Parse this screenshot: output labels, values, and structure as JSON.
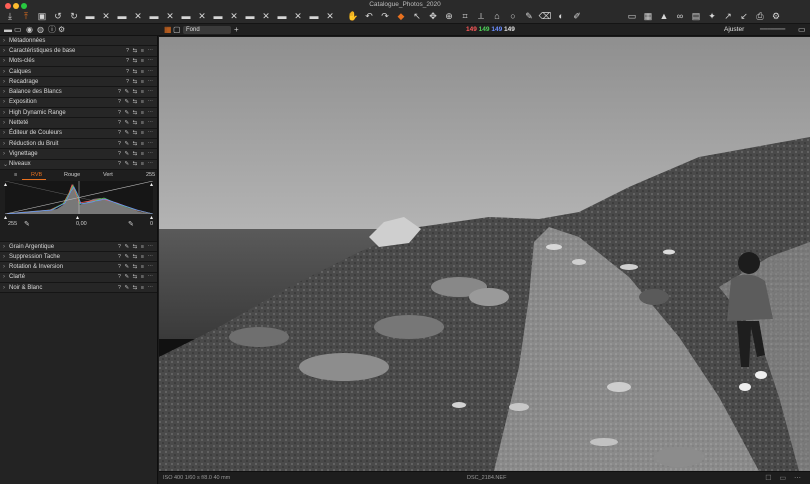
{
  "window": {
    "title": "Catalogue_Photos_2020"
  },
  "toolbar": {
    "icons_left": [
      "import-icon",
      "export-icon",
      "camera-icon",
      "rotate-left-icon",
      "rotate-right-icon",
      "folder-icon",
      "close-icon",
      "folder-icon",
      "close-icon",
      "folder-icon",
      "close-icon",
      "folder-icon",
      "close-icon",
      "folder-icon",
      "close-icon",
      "folder-icon",
      "close-icon",
      "folder-icon",
      "close-icon",
      "folder-icon",
      "close-icon"
    ],
    "icons_mid": [
      "hand-icon",
      "undo-icon",
      "redo-icon",
      "reset-icon",
      "cursor-icon",
      "pan-icon",
      "picker-icon",
      "crop-icon",
      "straighten-icon",
      "keystone-icon",
      "circle-mask-icon",
      "brush-icon",
      "eraser-icon",
      "gradient-icon",
      "annotation-icon"
    ],
    "icons_right": [
      "viewer-icon",
      "grid-icon",
      "warning-icon",
      "glasses-icon",
      "browser-icon",
      "wand-icon",
      "copy-adjust-icon",
      "apply-icon",
      "print-icon",
      "settings-icon"
    ]
  },
  "subbar": {
    "layer_select": "Fond",
    "readout_r": "149",
    "readout_g": "149",
    "readout_b": "149",
    "readout_l": "149",
    "fit_label": "Ajuster",
    "colors": {
      "r": "#ff5a5a",
      "g": "#4ed35a",
      "b": "#6a8dff",
      "l": "#e0e0e0"
    }
  },
  "tools_top": [
    {
      "label": "Métadonnées",
      "acts": ""
    },
    {
      "label": "Caractéristiques de base",
      "acts": "? ⇆ ≡ ⋯"
    },
    {
      "label": "Mots-clés",
      "acts": "? ⇆ ≡ ⋯"
    },
    {
      "label": "Calques",
      "acts": "? ⇆ ≡ ⋯"
    },
    {
      "label": "Recadrage",
      "acts": "? ⇆ ≡ ⋯"
    },
    {
      "label": "Balance des Blancs",
      "acts": "? ✎ ⇆ ≡ ⋯"
    },
    {
      "label": "Exposition",
      "acts": "? ✎ ⇆ ≡ ⋯"
    },
    {
      "label": "High Dynamic Range",
      "acts": "? ✎ ⇆ ≡ ⋯"
    },
    {
      "label": "Netteté",
      "acts": "? ✎ ⇆ ≡ ⋯"
    },
    {
      "label": "Éditeur de Couleurs",
      "acts": "? ✎ ⇆ ≡ ⋯"
    },
    {
      "label": "Réduction du Bruit",
      "acts": "? ✎ ⇆ ≡ ⋯"
    },
    {
      "label": "Vignettage",
      "acts": "? ✎ ⇆ ≡ ⋯"
    },
    {
      "label": "Niveaux",
      "acts": "? ✎ ⇆ ≡ ⋯"
    }
  ],
  "levels": {
    "tab_first": "≡",
    "tab_rgb": "RVB",
    "tab_red": "Rouge",
    "tab_green": "Vert",
    "top_right": "255",
    "bottom_left": "255",
    "bottom_mid": "0,00",
    "bottom_right": "0",
    "accent": "#e8711f"
  },
  "tools_bottom": [
    {
      "label": "Grain Argentique",
      "acts": "? ✎ ⇆ ≡ ⋯"
    },
    {
      "label": "Suppression Tache",
      "acts": "? ✎ ⇆ ≡ ⋯"
    },
    {
      "label": "Rotation & Inversion",
      "acts": "? ✎ ⇆ ≡ ⋯"
    },
    {
      "label": "Clarté",
      "acts": "? ✎ ⇆ ≡ ⋯"
    },
    {
      "label": "Noir & Blanc",
      "acts": "? ✎ ⇆ ≡ ⋯"
    }
  ],
  "status": {
    "exif": "ISO 400   1/60 s   f/8.0   40 mm",
    "filename": "DSC_2184.NEF"
  }
}
